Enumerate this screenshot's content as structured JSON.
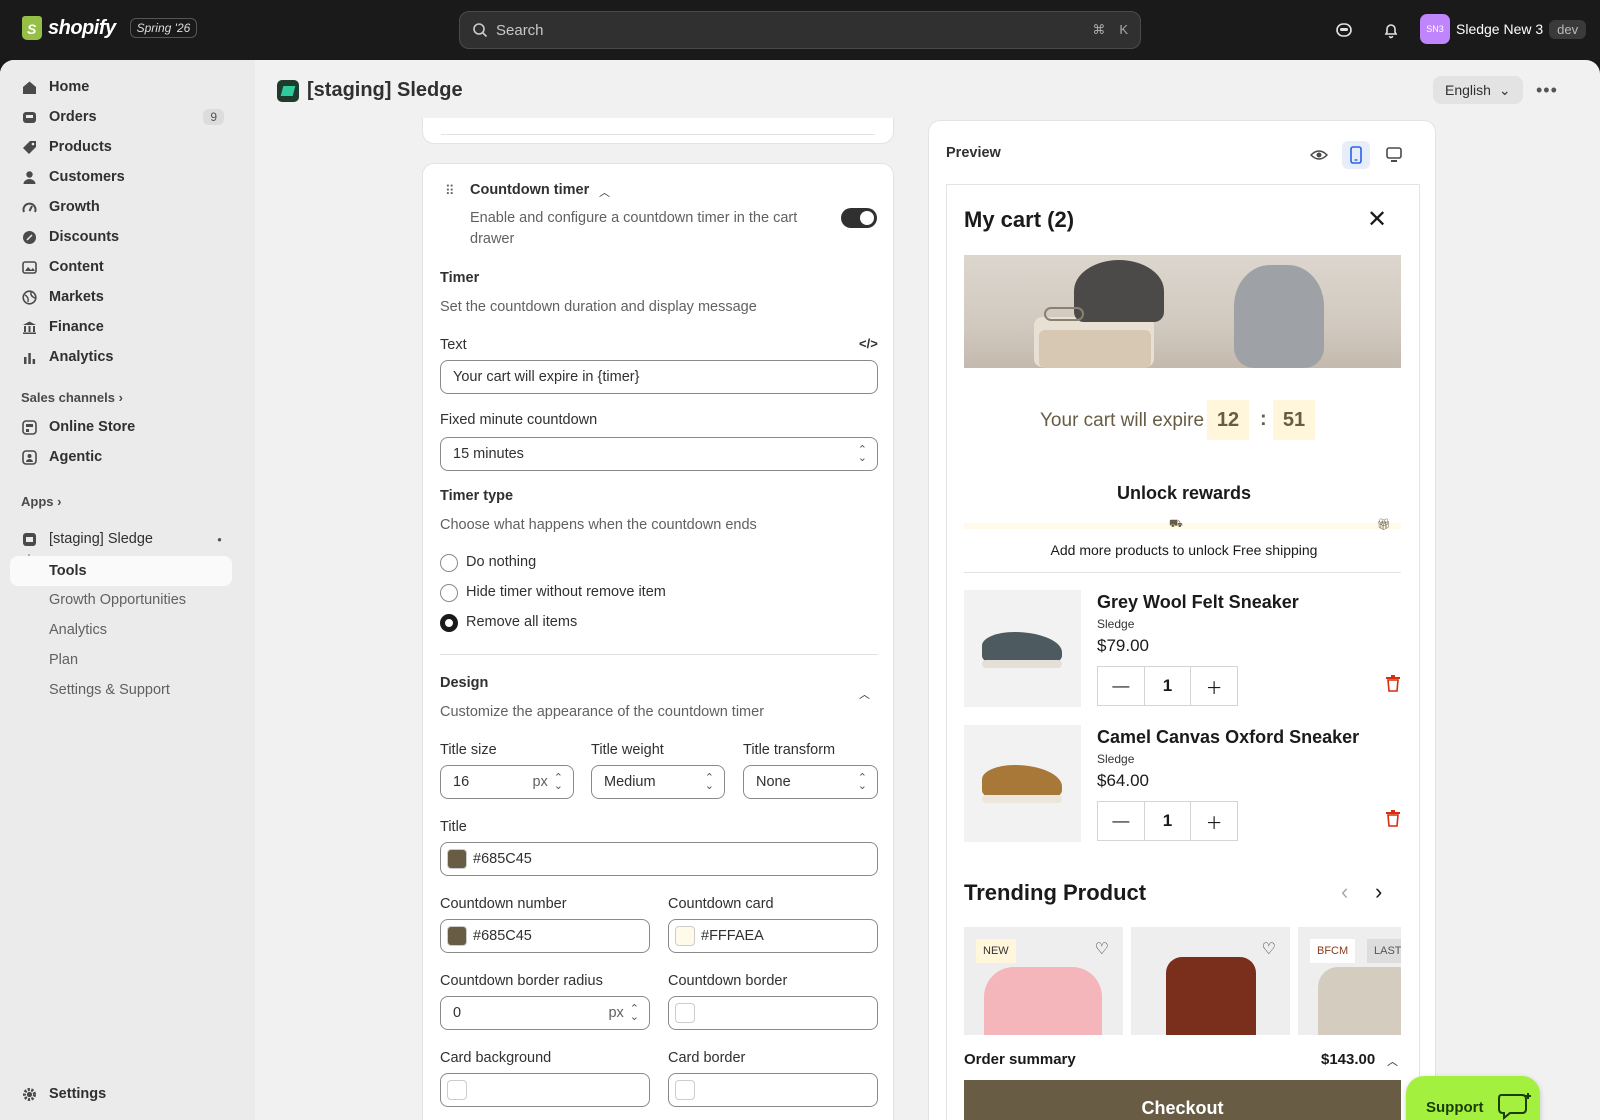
{
  "topbar": {
    "brand": "shopify",
    "edition": "Spring '26",
    "search_placeholder": "Search",
    "shortcut_cmd": "⌘",
    "shortcut_key": "K",
    "account_initials": "SN3",
    "account_name": "Sledge New 3",
    "account_badge": "dev"
  },
  "sidebar": {
    "items": [
      {
        "label": "Home"
      },
      {
        "label": "Orders",
        "count": "9"
      },
      {
        "label": "Products"
      },
      {
        "label": "Customers"
      },
      {
        "label": "Growth"
      },
      {
        "label": "Discounts"
      },
      {
        "label": "Content"
      },
      {
        "label": "Markets"
      },
      {
        "label": "Finance"
      },
      {
        "label": "Analytics"
      }
    ],
    "sales_channels_label": "Sales channels",
    "channels": [
      {
        "label": "Online Store"
      },
      {
        "label": "Agentic"
      }
    ],
    "apps_label": "Apps",
    "app_name": "[staging] Sledge",
    "app_sub": [
      {
        "label": "Tools"
      },
      {
        "label": "Growth Opportunities"
      },
      {
        "label": "Analytics"
      },
      {
        "label": "Plan"
      },
      {
        "label": "Settings & Support"
      }
    ],
    "settings_label": "Settings"
  },
  "header": {
    "title": "[staging] Sledge",
    "language": "English"
  },
  "editor": {
    "section_title": "Countdown timer",
    "section_desc_1": "Enable and configure a countdown timer in the cart",
    "section_desc_2": "drawer",
    "timer_heading": "Timer",
    "timer_desc": "Set the countdown duration and display message",
    "text_label": "Text",
    "text_value": "Your cart will expire in {timer}",
    "fixed_label": "Fixed minute countdown",
    "fixed_value": "15 minutes",
    "type_heading": "Timer type",
    "type_desc": "Choose what happens when the countdown ends",
    "options": [
      "Do nothing",
      "Hide timer without remove item",
      "Remove all items"
    ],
    "selected_option": "Remove all items",
    "design_heading": "Design",
    "design_desc": "Customize the appearance of the countdown timer",
    "title_size_label": "Title size",
    "title_size_value": "16",
    "unit": "px",
    "title_weight_label": "Title weight",
    "title_weight_value": "Medium",
    "title_transform_label": "Title transform",
    "title_transform_value": "None",
    "title_color_label": "Title",
    "title_color_value": "#685C45",
    "countdown_number_label": "Countdown number",
    "countdown_number_value": "#685C45",
    "countdown_card_label": "Countdown card",
    "countdown_card_value": "#FFFAEA",
    "border_radius_label": "Countdown border radius",
    "border_radius_value": "0",
    "countdown_border_label": "Countdown border",
    "card_background_label": "Card background",
    "card_border_label": "Card border"
  },
  "preview": {
    "label": "Preview",
    "cart_title": "My cart (2)",
    "expire_text": "Your cart will expire in",
    "minutes": "12",
    "sep": ":",
    "seconds": "51",
    "rewards_title": "Unlock rewards",
    "rewards_msg": "Add more products to unlock Free shipping",
    "products": [
      {
        "name": "Grey Wool Felt Sneaker",
        "vendor": "Sledge",
        "price": "$79.00",
        "qty": "1"
      },
      {
        "name": "Camel Canvas Oxford Sneaker",
        "vendor": "Sledge",
        "price": "$64.00",
        "qty": "1"
      }
    ],
    "trending_title": "Trending Product",
    "tag_new": "NEW",
    "tag_bfcm": "BFCM",
    "tag_last": "LAST",
    "summary_label": "Order summary",
    "summary_total": "$143.00",
    "checkout_label": "Checkout"
  },
  "support_label": "Support",
  "colors": {
    "brand_primary": "#685C45",
    "card": "#FFFAEA",
    "accent_support": "#A3F03E",
    "danger": "#D72C0D"
  }
}
